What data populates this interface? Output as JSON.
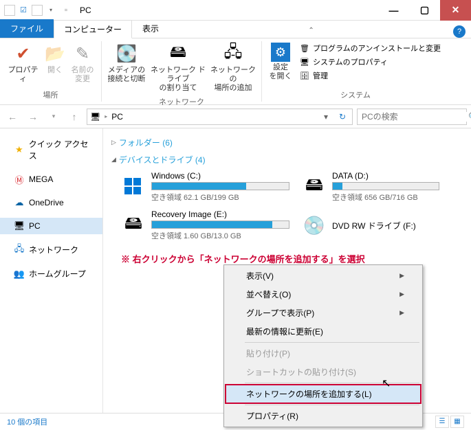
{
  "titlebar": {
    "title": "PC"
  },
  "tabs": {
    "file": "ファイル",
    "computer": "コンピューター",
    "view": "表示"
  },
  "ribbon": {
    "properties": "プロパティ",
    "open": "開く",
    "rename": "名前の\n変更",
    "group_location": "場所",
    "media": "メディアの\n接続と切断",
    "netdrive": "ネットワーク ドライブ\nの割り当て",
    "addloc": "ネットワークの\n場所の追加",
    "group_network": "ネットワーク",
    "settings": "設定\nを開く",
    "uninstall": "プログラムのアンインストールと変更",
    "sysprops": "システムのプロパティ",
    "manage": "管理",
    "group_system": "システム"
  },
  "addr": {
    "path": "PC"
  },
  "search": {
    "placeholder": "PCの検索"
  },
  "nav": {
    "quick": "クイック アクセス",
    "mega": "MEGA",
    "onedrive": "OneDrive",
    "pc": "PC",
    "network": "ネットワーク",
    "homegroup": "ホームグループ"
  },
  "sections": {
    "folders": "フォルダー (6)",
    "devices": "デバイスとドライブ (4)"
  },
  "drives": [
    {
      "name": "Windows (C:)",
      "sub": "空き領域 62.1 GB/199 GB",
      "fill": 69
    },
    {
      "name": "DATA (D:)",
      "sub": "空き領域 656 GB/716 GB",
      "fill": 9
    },
    {
      "name": "Recovery Image (E:)",
      "sub": "空き領域 1.60 GB/13.0 GB",
      "fill": 88
    },
    {
      "name": "DVD RW ドライブ (F:)",
      "sub": "",
      "fill": null
    }
  ],
  "annotation": "※ 右クリックから「ネットワークの場所を追加する」を選択",
  "ctx": {
    "view": "表示(V)",
    "sort": "並べ替え(O)",
    "group": "グループで表示(P)",
    "refresh": "最新の情報に更新(E)",
    "paste": "貼り付け(P)",
    "pasteshortcut": "ショートカットの貼り付け(S)",
    "addnetloc": "ネットワークの場所を追加する(L)",
    "properties": "プロパティ(R)"
  },
  "status": {
    "count": "10 個の項目"
  }
}
